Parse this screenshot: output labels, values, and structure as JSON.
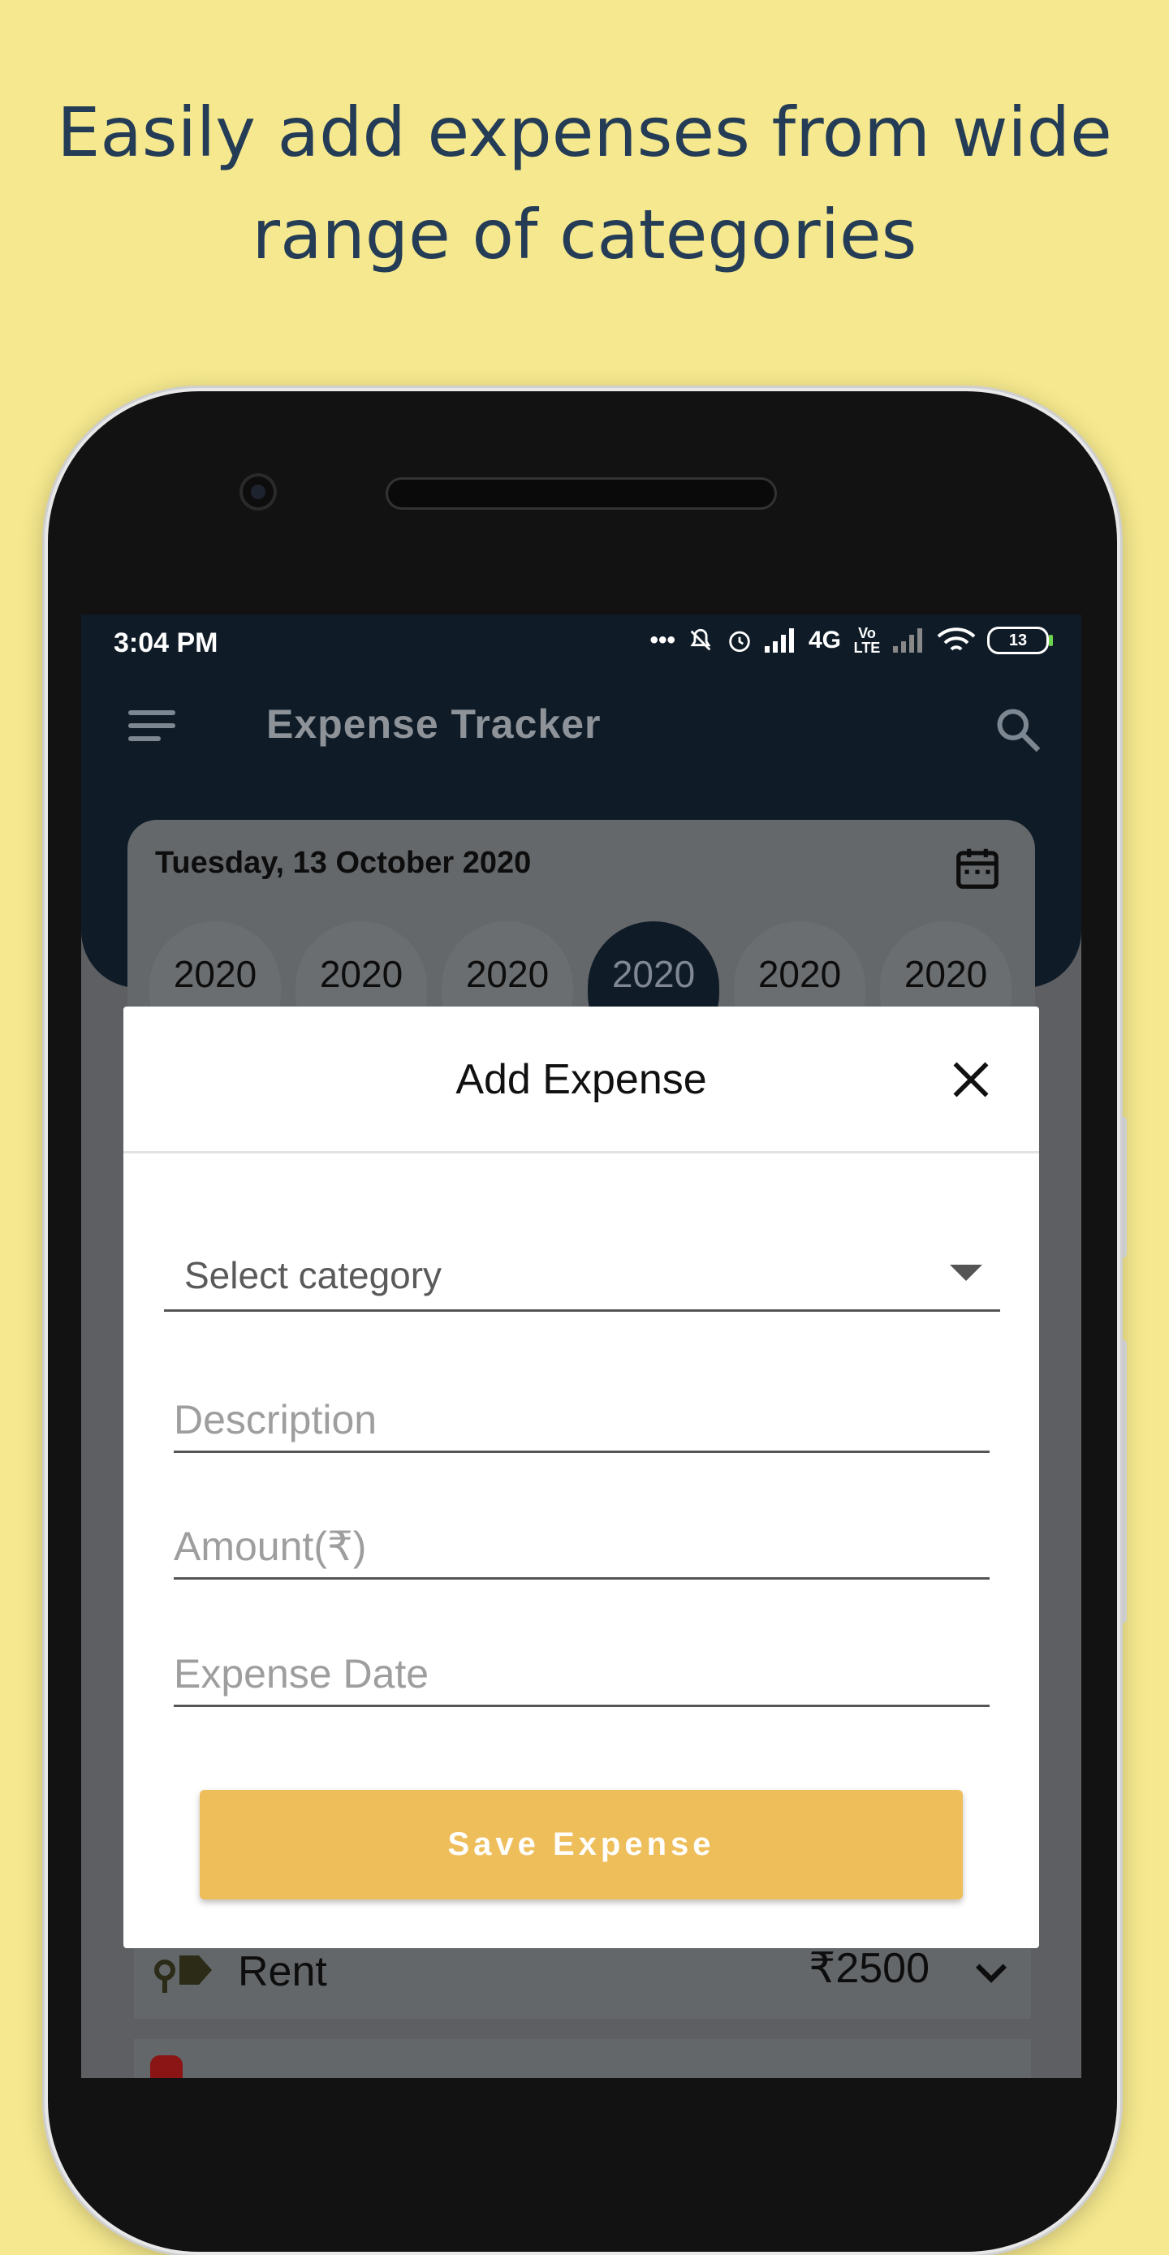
{
  "promo": {
    "headline_line1": "Easily add expenses from wide",
    "headline_line2": "range of categories"
  },
  "status_bar": {
    "time": "3:04 PM",
    "network": "4G",
    "volte": "Vo LTE",
    "battery": "13"
  },
  "app_bar": {
    "title": "Expense Tracker"
  },
  "date_card": {
    "date": "Tuesday, 13 October 2020",
    "years": [
      "2020",
      "2020",
      "2020",
      "2020",
      "2020",
      "2020"
    ],
    "active_index": 3
  },
  "dialog": {
    "title": "Add Expense",
    "category_placeholder": "Select category",
    "description_placeholder": "Description",
    "amount_placeholder": "Amount(₹)",
    "date_placeholder": "Expense Date",
    "save_label": "Save Expense"
  },
  "expenses": [
    {
      "name": "Rent",
      "amount": "₹2500",
      "icon": "key-tag-icon"
    }
  ],
  "colors": {
    "background": "#f5e88e",
    "headline": "#243c55",
    "app_header": "#0f1c28",
    "accent": "#eebe5b"
  }
}
